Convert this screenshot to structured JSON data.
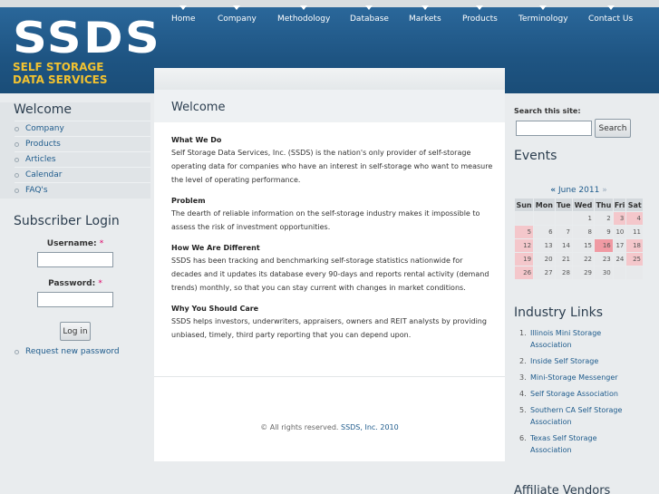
{
  "logo": {
    "big": "SSDS",
    "small": "SELF STORAGE",
    "small2": "DATA SERVICES"
  },
  "nav": [
    "Home",
    "Company",
    "Methodology",
    "Database",
    "Markets",
    "Products",
    "Terminology",
    "Contact Us"
  ],
  "sidebar": {
    "heading": "Welcome",
    "items": [
      "Company",
      "Products",
      "Articles",
      "Calendar",
      "FAQ's"
    ]
  },
  "login": {
    "heading": "Subscriber Login",
    "username_label": "Username:",
    "password_label": "Password:",
    "required_mark": "*",
    "button": "Log in",
    "request_password": "Request new password"
  },
  "main": {
    "title": "Welcome",
    "sections": [
      {
        "heading": "What We Do",
        "body": "Self Storage Data Services, Inc. (SSDS) is the nation's only provider of self-storage operating data for companies who have an interest in self-storage who want to measure the level of operating performance."
      },
      {
        "heading": "Problem",
        "body": "The dearth of reliable information on the self-storage industry makes it impossible to assess the risk of investment opportunities."
      },
      {
        "heading": "How We Are Different",
        "body": "SSDS has been tracking and benchmarking self-storage statistics nationwide for decades and it updates its database every 90-days and reports rental activity (demand trends) monthly, so that you can stay current with changes in market conditions."
      },
      {
        "heading": "Why You Should Care",
        "body": "SSDS helps investors, underwriters, appraisers, owners and REIT analysts by providing unbiased, timely, third party reporting that you can depend upon."
      }
    ],
    "footer_prefix": "© All rights reserved.",
    "footer_link": "SSDS, Inc. 2010"
  },
  "search": {
    "label": "Search this site:",
    "button": "Search"
  },
  "events": {
    "heading": "Events",
    "prev": "«",
    "month": "June 2011",
    "next": "»",
    "days": [
      "Sun",
      "Mon",
      "Tue",
      "Wed",
      "Thu",
      "Fri",
      "Sat"
    ],
    "weeks": [
      [
        "",
        "",
        "",
        "1",
        "2",
        "3",
        "4"
      ],
      [
        "5",
        "6",
        "7",
        "8",
        "9",
        "10",
        "11"
      ],
      [
        "12",
        "13",
        "14",
        "15",
        "16",
        "17",
        "18"
      ],
      [
        "19",
        "20",
        "21",
        "22",
        "23",
        "24",
        "25"
      ],
      [
        "26",
        "27",
        "28",
        "29",
        "30",
        "",
        ""
      ]
    ]
  },
  "industry_links": {
    "heading": "Industry Links",
    "items": [
      {
        "num": "1.",
        "line1": "Illinois Mini Storage",
        "line2": "Association"
      },
      {
        "num": "2.",
        "line1": "Inside Self Storage",
        "line2": ""
      },
      {
        "num": "3.",
        "line1": "Mini-Storage Messenger",
        "line2": ""
      },
      {
        "num": "4.",
        "line1": "Self Storage Association",
        "line2": ""
      },
      {
        "num": "5.",
        "line1": "Southern CA Self Storage",
        "line2": "Association"
      },
      {
        "num": "6.",
        "line1": "Texas Self Storage",
        "line2": "Association"
      }
    ]
  },
  "affiliate_heading": "Affiliate Vendors"
}
